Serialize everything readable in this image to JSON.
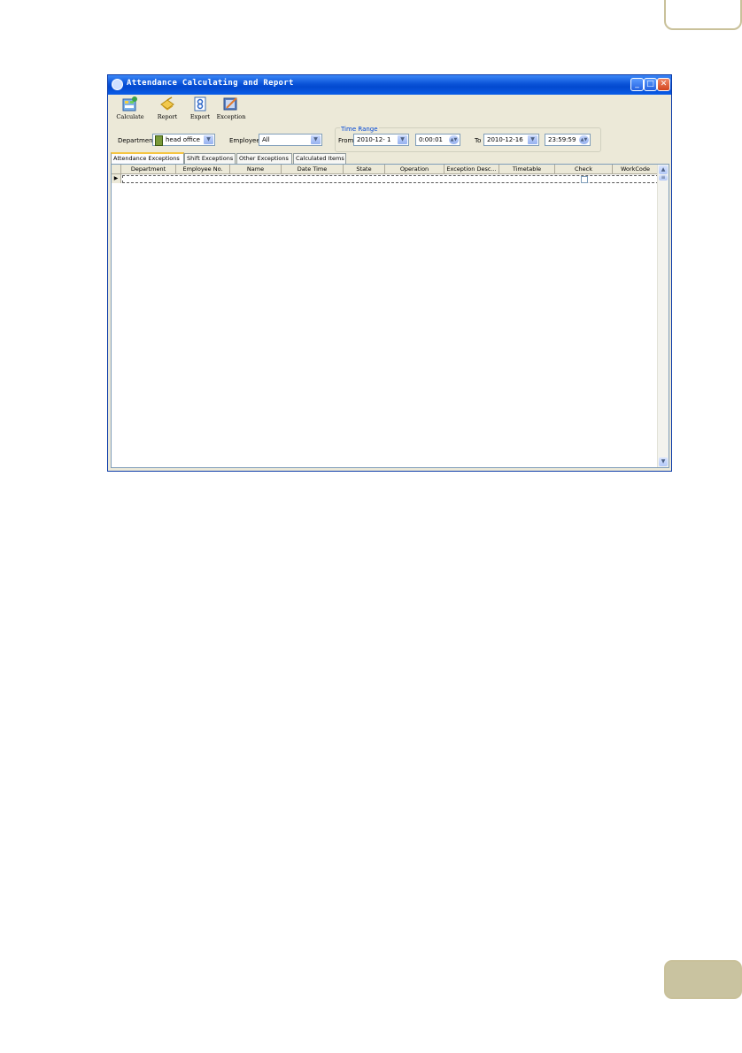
{
  "window": {
    "title": "Attendance Calculating and Report",
    "controls": [
      "_",
      "□",
      "✕"
    ]
  },
  "toolbar": [
    {
      "label": "Calculate",
      "icon": "calculate-icon"
    },
    {
      "label": "Report",
      "icon": "report-icon"
    },
    {
      "label": "Export",
      "icon": "export-icon"
    },
    {
      "label": "Exception",
      "icon": "exception-icon"
    }
  ],
  "filters": {
    "department_label": "Department",
    "department_value": "head office",
    "employee_label": "Employee",
    "employee_value": "All",
    "time_range_title": "Time Range",
    "from_label": "From",
    "from_date": "2010-12- 1",
    "from_time": "0:00:01",
    "to_label": "To",
    "to_date": "2010-12-16",
    "to_time": "23:59:59"
  },
  "tabs": [
    "Attendance Exceptions",
    "Shift Exceptions",
    "Other Exceptions",
    "Calculated Items"
  ],
  "grid": {
    "columns": [
      "Department",
      "Employee No.",
      "Name",
      "Date Time",
      "State",
      "Operation",
      "Exception Desc...",
      "Timetable",
      "Check",
      "WorkCode"
    ]
  },
  "colors": {
    "titlebar": "#0a53d8",
    "window_face": "#ece9d8",
    "accent_tab": "#f5c542",
    "page_tab": "#c9c3a0"
  }
}
